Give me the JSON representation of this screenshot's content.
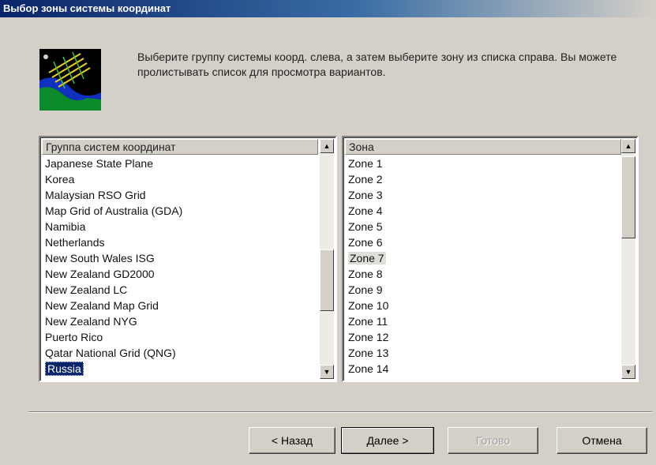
{
  "window": {
    "title": "Выбор зоны системы координат"
  },
  "instructions": "Выберите группу системы коорд. слева, а затем выберите зону из списка справа. Вы можете пролистывать список для просмотра вариантов.",
  "icon": "globe-grid-icon",
  "groups": {
    "header": "Группа систем координат",
    "items": [
      "Japanese State Plane",
      "Korea",
      "Malaysian RSO Grid",
      "Map Grid of Australia (GDA)",
      "Namibia",
      "Netherlands",
      "New South Wales ISG",
      "New Zealand GD2000",
      "New Zealand LC",
      "New Zealand Map Grid",
      "New Zealand NYG",
      "Puerto Rico",
      "Qatar National Grid (QNG)",
      "Russia"
    ],
    "selected": "Russia"
  },
  "zones": {
    "header": "Зона",
    "items": [
      "Zone 1",
      "Zone 2",
      "Zone 3",
      "Zone 4",
      "Zone 5",
      "Zone 6",
      "Zone 7",
      "Zone 8",
      "Zone 9",
      "Zone 10",
      "Zone 11",
      "Zone 12",
      "Zone 13",
      "Zone 14"
    ],
    "highlighted": "Zone 7"
  },
  "buttons": {
    "back": "< Назад",
    "next": "Далее >",
    "finish": "Готово",
    "cancel": "Отмена"
  }
}
